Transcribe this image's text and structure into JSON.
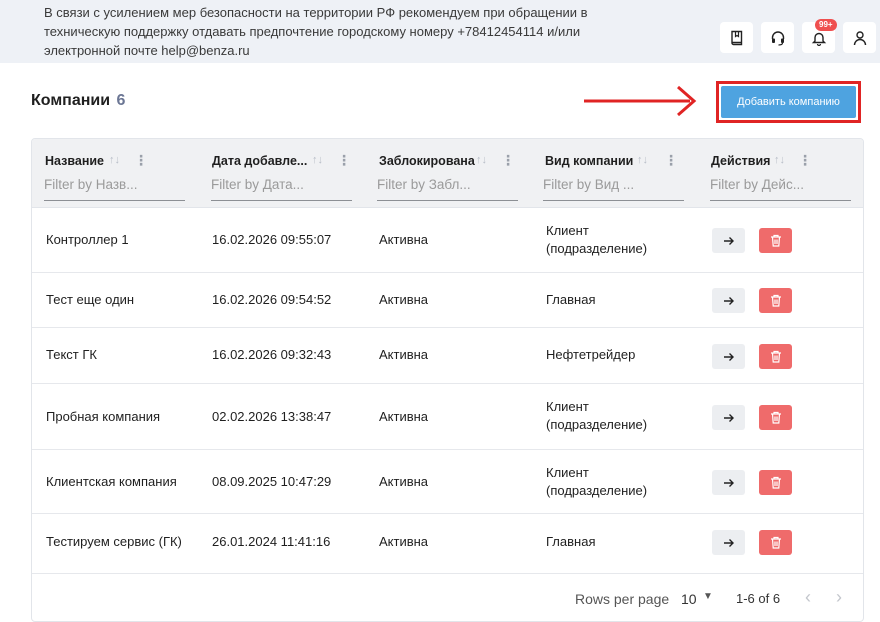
{
  "notice": "В связи с усилением мер безопасности на территории РФ рекомендуем при обращении в техническую поддержку отдавать предпочтение городскому номеру +78412454114 и/или электронной почте help@benza.ru",
  "header_icons": [
    "book-icon",
    "headset-icon",
    "bell-icon",
    "user-icon"
  ],
  "notifications_badge": "99+",
  "page": {
    "title": "Компании",
    "count": "6"
  },
  "add_button_label": "Добавить компанию",
  "columns": [
    {
      "label": "Название",
      "filter_placeholder": "Filter by Назв..."
    },
    {
      "label": "Дата добавле...",
      "filter_placeholder": "Filter by Дата..."
    },
    {
      "label": "Заблокирована",
      "filter_placeholder": "Filter by Забл..."
    },
    {
      "label": "Вид компании",
      "filter_placeholder": "Filter by Вид ..."
    },
    {
      "label": "Действия",
      "filter_placeholder": "Filter by Дейс..."
    }
  ],
  "rows": [
    {
      "name": "Контроллер 1",
      "date": "16.02.2026 09:55:07",
      "status": "Активна",
      "type": "Клиент (подразделение)"
    },
    {
      "name": "Тест еще один",
      "date": "16.02.2026 09:54:52",
      "status": "Активна",
      "type": "Главная"
    },
    {
      "name": "Текст ГК",
      "date": "16.02.2026 09:32:43",
      "status": "Активна",
      "type": "Нефтетрейдер"
    },
    {
      "name": "Пробная компания",
      "date": "02.02.2026 13:38:47",
      "status": "Активна",
      "type": "Клиент (подразделение)"
    },
    {
      "name": "Клиентская компания",
      "date": "08.09.2025 10:47:29",
      "status": "Активна",
      "type": "Клиент (подразделение)"
    },
    {
      "name": "Тестируем сервис (ГК)",
      "date": "26.01.2024 11:41:16",
      "status": "Активна",
      "type": "Главная"
    }
  ],
  "pagination": {
    "rows_per_page_label": "Rows per page",
    "rows_per_page": "10",
    "range": "1-6 of 6"
  },
  "colors": {
    "accent": "#4ea3e0",
    "danger": "#ef6b6b",
    "annotation": "#e02424"
  }
}
